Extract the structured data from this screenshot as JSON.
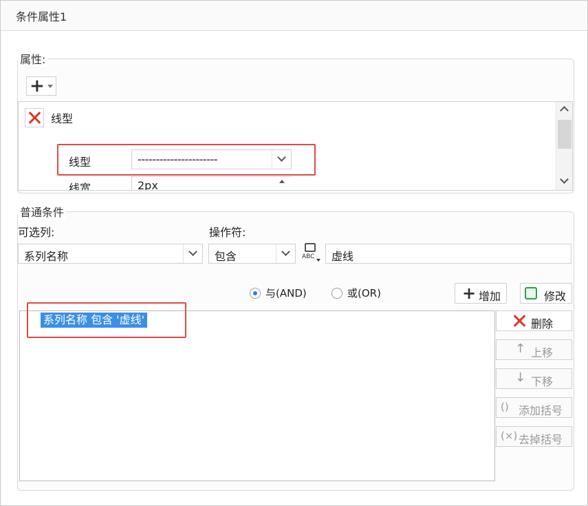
{
  "window": {
    "title": "条件属性1"
  },
  "properties_group": {
    "legend": "属性:",
    "add_button_glyph": "+",
    "property_name": "线型",
    "line_type": {
      "label": "线型",
      "value": "----------------------"
    },
    "line_width": {
      "label": "线宽",
      "value": "2px"
    }
  },
  "condition_group": {
    "legend": "普通条件",
    "column_label": "可选列:",
    "column_value": "系列名称",
    "operator_label": "操作符:",
    "operator_value": "包含",
    "abc_icon_text": "ABC",
    "value_input": "虚线",
    "and_label": "与(AND)",
    "or_label": "或(OR)",
    "and_selected": true,
    "add_button": "增加",
    "modify_button": "修改",
    "conditions": [
      "系列名称 包含 '虚线'"
    ],
    "delete_button": "删除",
    "move_up_button": "上移",
    "move_down_button": "下移",
    "add_paren_button": "添加括号",
    "remove_paren_button": "去掉括号"
  },
  "colors": {
    "accent": "#2a7de1",
    "highlight": "#e04848",
    "selection": "#3b8fe6",
    "delete": "#e0322b",
    "modify_icon": "#2e9d4a"
  }
}
